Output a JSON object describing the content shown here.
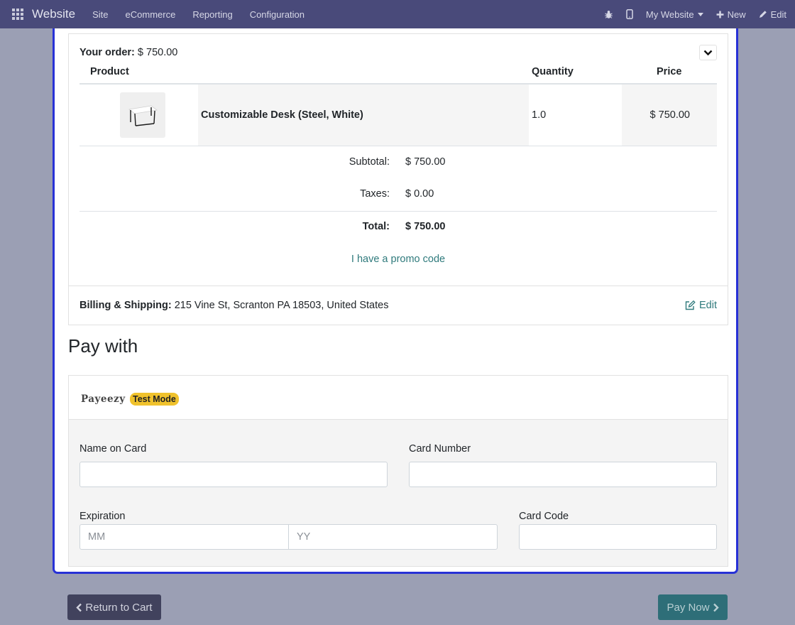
{
  "navbar": {
    "brand": "Website",
    "menu": [
      "Site",
      "eCommerce",
      "Reporting",
      "Configuration"
    ],
    "website_selector": "My Website",
    "new_label": "New",
    "edit_label": "Edit"
  },
  "order": {
    "title_label": "Your order:",
    "title_amount": "$ 750.00",
    "columns": {
      "product": "Product",
      "quantity": "Quantity",
      "price": "Price"
    },
    "lines": [
      {
        "product": "Customizable Desk (Steel, White)",
        "quantity": "1.0",
        "price": "$ 750.00"
      }
    ],
    "subtotal_label": "Subtotal:",
    "subtotal_value": "$ 750.00",
    "taxes_label": "Taxes:",
    "taxes_value": "$ 0.00",
    "total_label": "Total:",
    "total_value": "$ 750.00",
    "promo_link": "I have a promo code"
  },
  "billing": {
    "label": "Billing & Shipping:",
    "address": "215 Vine St, Scranton PA 18503, United States",
    "edit_label": "Edit"
  },
  "payment": {
    "heading": "Pay with",
    "provider": "Payeezy",
    "badge": "Test Mode",
    "name_label": "Name on Card",
    "name_value": "",
    "card_number_label": "Card Number",
    "card_number_value": "",
    "expiration_label": "Expiration",
    "month_placeholder": "MM",
    "year_placeholder": "YY",
    "card_code_label": "Card Code",
    "card_code_value": ""
  },
  "actions": {
    "return_label": "Return to Cart",
    "pay_label": "Pay Now"
  },
  "colors": {
    "navbar": "#494a7a",
    "frame_highlight": "#2731d6",
    "link": "#2f7a7c",
    "badge": "#f0c22d",
    "pay_button": "#2e6e78",
    "return_button": "#41425d"
  }
}
